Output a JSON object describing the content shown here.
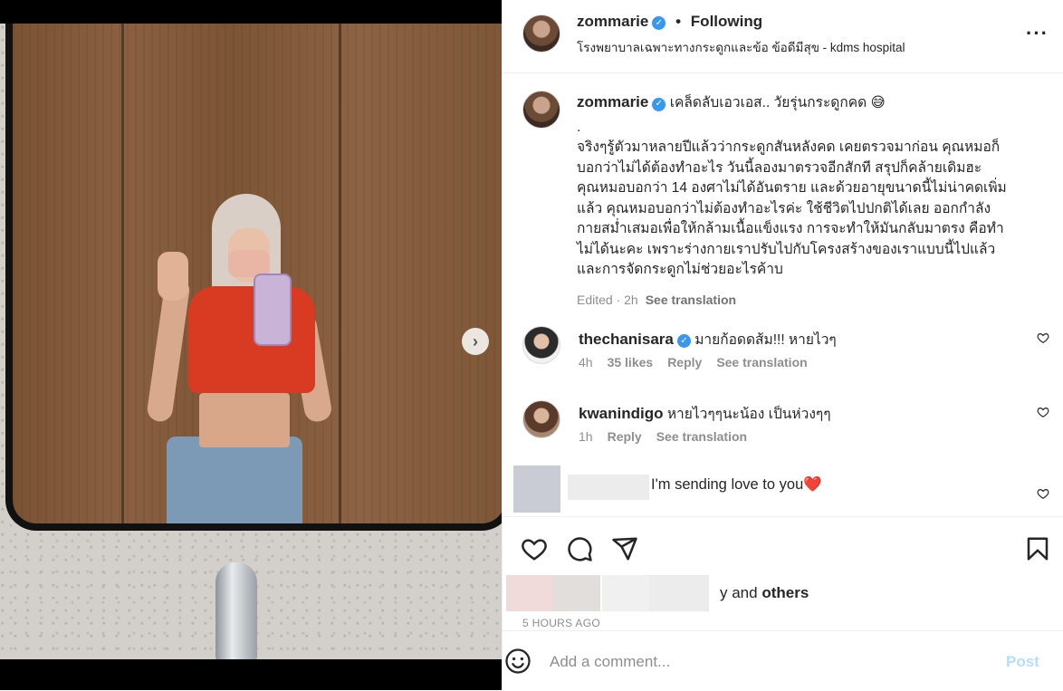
{
  "post": {
    "author": "zommarie",
    "verified_mark": "✓",
    "dot": "•",
    "follow_status": "Following",
    "location": "โรงพยาบาลเฉพาะทางกระดูกและข้อ ข้อดีมีสุข - kdms hospital",
    "more_icon": "more-horizontal-icon",
    "caption_title": "เคล็ดลับเอวเอส.. วัยรุ่นกระดูกคด 😅",
    "caption_body": ".\nจริงๆรู้ตัวมาหลายปีแล้วว่ากระดูกสันหลังคด เคยตรวจมาก่อน คุณหมอก็\nบอกว่าไม่ได้ต้องทำอะไร วันนี้ลองมาตรวจอีกสักที สรุปก็คล้ายเดิมฮะ\nคุณหมอบอกว่า 14 องศาไม่ได้อันตราย และด้วยอายุขนาดนี้ไม่น่าคดเพิ่ม\nแล้ว คุณหมอบอกว่าไม่ต้องทำอะไรค่ะ ใช้ชีวิตไปปกติได้เลย ออกกำลัง\nกายสม่ำเสมอเพื่อให้กล้ามเนื้อแข็งแรง การจะทำให้มันกลับมาตรง คือทำ\nไม่ได้นะคะ เพราะร่างกายเราปรับไปกับโครงสร้างของเราแบบนี้ไปแล้ว\nและการจัดกระดูกไม่ช่วยอะไรค้าบ",
    "caption_meta": "Edited · 2h",
    "see_translation": "See translation"
  },
  "comments": [
    {
      "user": "thechanisara",
      "verified": true,
      "text": "มายก้อดดส้ม!!! หายไวๆ",
      "time": "4h",
      "likes": "35 likes",
      "reply": "Reply",
      "translate": "See translation"
    },
    {
      "user": "kwanindigo",
      "verified": false,
      "text": "หายไวๆๆนะน้อง เป็นห่วงๆๆ",
      "time": "1h",
      "reply": "Reply",
      "translate": "See translation"
    },
    {
      "user": "",
      "verified": false,
      "text": "I'm sending love to you❤️"
    }
  ],
  "actions": {
    "icons": [
      "heart-icon",
      "comment-icon",
      "share-icon",
      "bookmark-icon"
    ],
    "likes_suffix": "y and ",
    "likes_others": "others",
    "timestamp": "5 HOURS AGO"
  },
  "composer": {
    "emoji_icon": "emoji-icon",
    "placeholder": "Add a comment...",
    "post_label": "Post"
  },
  "colors": {
    "link_blue": "#3897f0",
    "post_disabled": "#b2dffc",
    "heart_red": "#e0245e",
    "secondary_text": "#8e8e8e"
  }
}
